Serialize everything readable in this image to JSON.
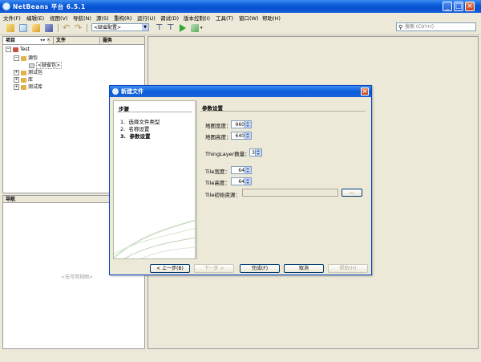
{
  "window": {
    "title": "NetBeans 平台 6.5.1"
  },
  "menu": {
    "items": [
      "文件(F)",
      "编辑(E)",
      "视图(V)",
      "导航(N)",
      "源(S)",
      "重构(R)",
      "运行(U)",
      "调试(D)",
      "版本控制(I)",
      "工具(T)",
      "窗口(W)",
      "帮助(H)"
    ]
  },
  "toolbar": {
    "config_value": "<缺省配置>",
    "search_placeholder": "搜索 (Ctrl+I)"
  },
  "projects": {
    "tabs": [
      "项目",
      "文件",
      "服务"
    ],
    "tree": [
      {
        "label": "Test"
      },
      {
        "label": "源包"
      },
      {
        "label": "<缺省包>"
      },
      {
        "label": "测试包"
      },
      {
        "label": "库"
      },
      {
        "label": "测试库"
      }
    ]
  },
  "navigator": {
    "title": "导航",
    "empty_text": "<无可用视图>"
  },
  "dialog": {
    "title": "新建文件",
    "steps_heading": "步骤",
    "steps": [
      {
        "num": "1.",
        "label": "选择文件类型"
      },
      {
        "num": "2.",
        "label": "名称设置"
      },
      {
        "num": "3.",
        "label": "参数设置"
      }
    ],
    "section_heading": "参数设置",
    "fields": {
      "map_width_label": "地图宽度：",
      "map_width": "960",
      "map_height_label": "地图高度：",
      "map_height": "640",
      "thinglayer_label": "ThingLayer数量：",
      "thinglayer": "3",
      "tile_width_label": "Tile宽度：",
      "tile_width": "64",
      "tile_height_label": "Tile高度：",
      "tile_height": "64",
      "tile_resource_label": "Tile初始资源：",
      "browse_label": "..."
    },
    "buttons": {
      "back": "< 上一步(B)",
      "next": "下一步 >",
      "finish": "完成(F)",
      "cancel": "取消",
      "help": "帮助(H)"
    }
  }
}
